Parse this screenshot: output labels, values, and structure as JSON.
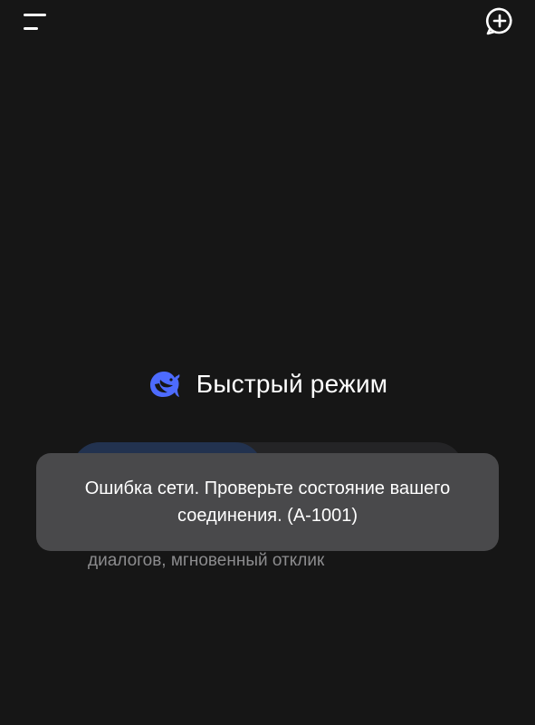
{
  "header": {
    "menu_icon": "menu-icon",
    "new_chat_icon": "new-chat-icon"
  },
  "mode": {
    "logo_icon": "deepseek-whale-logo-icon",
    "title": "Быстрый режим",
    "description": "диалогов, мгновенный отклик"
  },
  "toast": {
    "message": "Ошибка сети. Проверьте состояние вашего соединения. (A-1001)"
  },
  "colors": {
    "background": "#161616",
    "brand": "#4d6bfe",
    "toast_bg": "#49494b",
    "segment_active": "#22324f",
    "muted_text": "#8c8c8e"
  }
}
